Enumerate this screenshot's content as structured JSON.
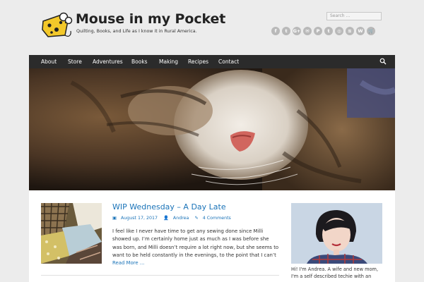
{
  "site": {
    "title": "Mouse in my Pocket",
    "tagline": "Quilting, Books, and Life as I know it in Rural America."
  },
  "header": {
    "search_placeholder": "Search ...",
    "social_icons": [
      {
        "name": "facebook-icon",
        "glyph": "f"
      },
      {
        "name": "twitter-icon",
        "glyph": "t"
      },
      {
        "name": "google-plus-icon",
        "glyph": "G+"
      },
      {
        "name": "email-icon",
        "glyph": "✉"
      },
      {
        "name": "pinterest-icon",
        "glyph": "P"
      },
      {
        "name": "tumblr-icon",
        "glyph": "t"
      },
      {
        "name": "instagram-icon",
        "glyph": "◎"
      },
      {
        "name": "spotify-icon",
        "glyph": "≋"
      },
      {
        "name": "wordpress-icon",
        "glyph": "W"
      },
      {
        "name": "cart-icon",
        "glyph": "🛒"
      }
    ]
  },
  "nav": {
    "items": [
      "About",
      "Store",
      "Adventures",
      "Books",
      "Making",
      "Recipes",
      "Contact"
    ]
  },
  "post": {
    "title": "WIP Wednesday – A Day Late",
    "date": "August 17, 2017",
    "author": "Andrea",
    "comments": "4 Comments",
    "excerpt": "I feel like I never have time to get any sewing done since Milli showed up.  I’m certainly home just as much as I was before she was born, and Milli doesn’t require a lot right now, but she seems to want to be held constantly in the evenings, to the point that I can’t",
    "read_more": "Read More ..."
  },
  "sidebar": {
    "intro": "Hi! I'm Andrea. A wife and new mom, I'm a self described techie with an"
  },
  "colors": {
    "background": "#ececec",
    "nav_bg": "#2b2b2b",
    "link": "#1a73b8",
    "social_icon": "#b9b9b9"
  }
}
